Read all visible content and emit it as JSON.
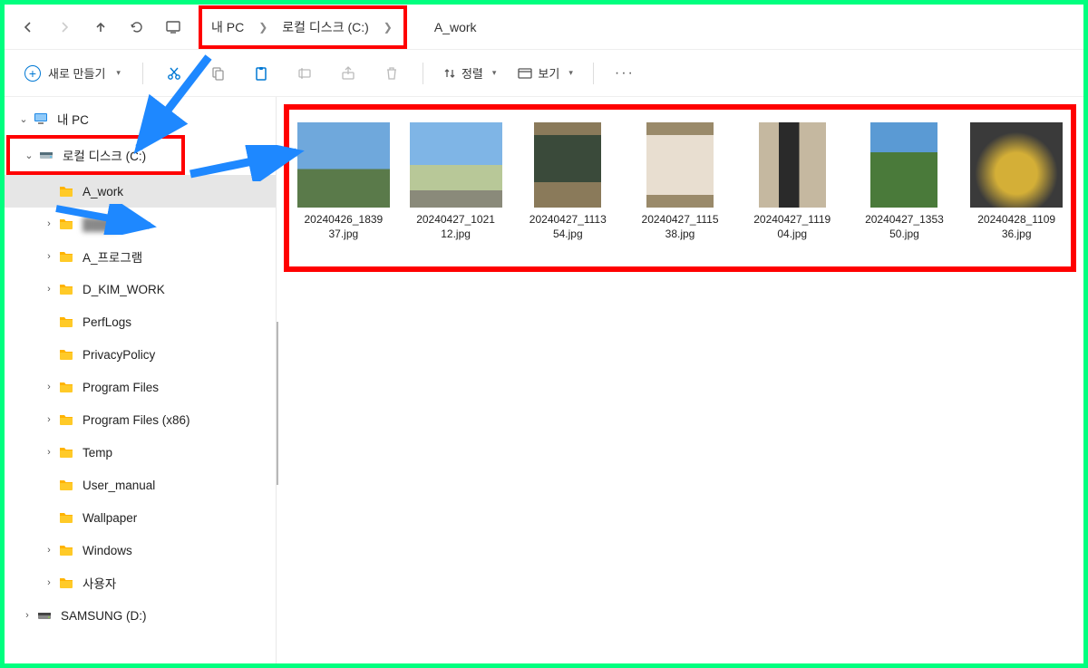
{
  "nav": {
    "back": "←",
    "forward": "→",
    "up": "↑",
    "refresh": "⟳"
  },
  "breadcrumb": {
    "root": "내 PC",
    "drive": "로컬 디스크 (C:)",
    "current": "A_work"
  },
  "toolbar": {
    "new_label": "새로 만들기",
    "sort_label": "정렬",
    "view_label": "보기",
    "more": "···"
  },
  "sidebar": {
    "pc": "내 PC",
    "drive_c": "로컬 디스크 (C:)",
    "items": [
      {
        "label": "A_work",
        "expandable": false,
        "selected": true,
        "indent": 2
      },
      {
        "label": "████",
        "expandable": true,
        "blur": true,
        "indent": 2
      },
      {
        "label": "A_프로그램",
        "expandable": true,
        "indent": 2
      },
      {
        "label": "D_KIM_WORK",
        "expandable": true,
        "indent": 2
      },
      {
        "label": "PerfLogs",
        "expandable": false,
        "indent": 2
      },
      {
        "label": "PrivacyPolicy",
        "expandable": false,
        "indent": 2
      },
      {
        "label": "Program Files",
        "expandable": true,
        "indent": 2
      },
      {
        "label": "Program Files (x86)",
        "expandable": true,
        "indent": 2
      },
      {
        "label": "Temp",
        "expandable": true,
        "indent": 2
      },
      {
        "label": "User_manual",
        "expandable": false,
        "indent": 2
      },
      {
        "label": "Wallpaper",
        "expandable": false,
        "indent": 2
      },
      {
        "label": "Windows",
        "expandable": true,
        "indent": 2
      },
      {
        "label": "사용자",
        "expandable": true,
        "indent": 2
      }
    ],
    "drive_d": "SAMSUNG (D:)"
  },
  "files": [
    {
      "name": "20240426_183937.jpg",
      "orient": "landscape",
      "thumb": "sky-buildings"
    },
    {
      "name": "20240427_102112.jpg",
      "orient": "landscape",
      "thumb": "garden-statues"
    },
    {
      "name": "20240427_111354.jpg",
      "orient": "portrait",
      "thumb": "painting-dark"
    },
    {
      "name": "20240427_111538.jpg",
      "orient": "portrait",
      "thumb": "painting-white"
    },
    {
      "name": "20240427_111904.jpg",
      "orient": "portrait",
      "thumb": "statue-dark"
    },
    {
      "name": "20240427_135350.jpg",
      "orient": "portrait",
      "thumb": "lawn-monument"
    },
    {
      "name": "20240428_110936.jpg",
      "orient": "landscape",
      "thumb": "gold-sculpture"
    }
  ],
  "thumbs": {
    "sky-buildings": {
      "bg": "linear-gradient(#6fa8dc 0 55%, #5a7a4a 55% 100%)"
    },
    "garden-statues": {
      "bg": "linear-gradient(#7fb5e6 0 50%, #b8c898 50% 80%, #8a8a7a 80% 100%)"
    },
    "painting-dark": {
      "bg": "linear-gradient(#8a7a5a 0 15%, #3a4a3a 15% 70%, #8a7a5a 70% 100%)"
    },
    "painting-white": {
      "bg": "linear-gradient(#9a8a6a 0 15%, #e8ded0 15% 85%, #9a8a6a 85% 100%)"
    },
    "statue-dark": {
      "bg": "linear-gradient(90deg,#c5b8a0 0 30%, #2a2a2a 30% 60%, #c5b8a0 60% 100%)"
    },
    "lawn-monument": {
      "bg": "linear-gradient(#5a9ad4 0 35%, #4a7a3a 35% 100%)"
    },
    "gold-sculpture": {
      "bg": "radial-gradient(circle at 50% 60%, #d4af37 0 30%, #3a3a3a 60% 100%)"
    }
  }
}
